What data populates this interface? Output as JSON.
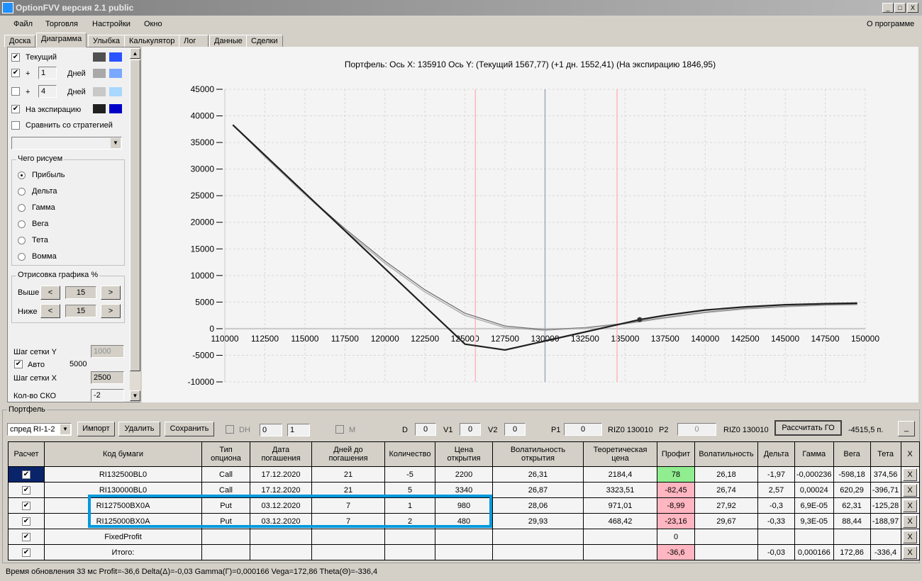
{
  "window": {
    "title": "OptionFVV версия 2.1 public",
    "min": "_",
    "max": "□",
    "close": "X"
  },
  "menu": [
    "Файл",
    "Торговля",
    "Настройки",
    "Окно"
  ],
  "about": "О программе",
  "tabs": [
    "Доска",
    "Диаграмма",
    "Улыбка",
    "Калькулятор",
    "Лог",
    "Данные",
    "Сделки"
  ],
  "left": {
    "current": "Текущий",
    "plus": "+",
    "days": "Дней",
    "days1": "1",
    "days2": "4",
    "expiry": "На экспирацию",
    "compare": "Сравнить со стратегией",
    "what_caption": "Чего рисуем",
    "radios": [
      "Прибыль",
      "Дельта",
      "Гамма",
      "Вега",
      "Тета",
      "Вомма"
    ],
    "draw_caption": "Отрисовка графика %",
    "above": "Выше",
    "below": "Ниже",
    "above_val": "15",
    "below_val": "15",
    "lt": "<",
    "gt": ">",
    "grid_y": "Шаг сетки Y",
    "grid_y_val": "1000",
    "auto": "Авто",
    "auto_val": "5000",
    "grid_x": "Шаг сетки X",
    "grid_x_val": "2500",
    "sko": "Кол-во СКО",
    "sko_val": "-2",
    "colors": {
      "current": [
        "#505050",
        "#2a52ff"
      ],
      "plus1": [
        "#a8a8a8",
        "#78a8ff"
      ],
      "plus4": [
        "#c8c8c8",
        "#a8d8ff"
      ],
      "expiry": [
        "#202020",
        "#0000c8"
      ]
    }
  },
  "chart_data": {
    "type": "line",
    "title": "Портфель: Ось X: 135910 Ось Y:  (Текущий 1567,77)  (+1 дн. 1552,41)  (На экспирацию 1846,95)",
    "xlim": [
      110000,
      150000
    ],
    "ylim": [
      -10000,
      45000
    ],
    "grid": true,
    "xticks": [
      110000,
      112500,
      115000,
      117500,
      120000,
      122500,
      125000,
      127500,
      130000,
      132500,
      135000,
      137500,
      140000,
      142500,
      145000,
      147500,
      150000
    ],
    "yticks": [
      45000,
      40000,
      35000,
      30000,
      25000,
      20000,
      15000,
      10000,
      5000,
      0,
      -5000,
      -10000
    ],
    "vlines": [
      {
        "x": 125650,
        "color": "#ffb6c1"
      },
      {
        "x": 130000,
        "color": "#a0a8b8"
      },
      {
        "x": 134500,
        "color": "#ffb6c1"
      }
    ],
    "marker": {
      "x": 135910,
      "y": 1700
    },
    "series": [
      {
        "name": "Текущий",
        "color": "#707070",
        "x": [
          110500,
          112500,
          115000,
          117500,
          120000,
          122500,
          125000,
          127500,
          130000,
          132500,
          135000,
          137500,
          140000,
          142500,
          145000,
          147500,
          149500
        ],
        "y": [
          38300,
          32400,
          25400,
          18800,
          12700,
          7300,
          2900,
          500,
          -200,
          200,
          1000,
          2100,
          3100,
          3800,
          4200,
          4500,
          4600
        ]
      },
      {
        "name": "+1 дн.",
        "color": "#a8a8a8",
        "x": [
          110500,
          112500,
          115000,
          117500,
          120000,
          122500,
          125000,
          127500,
          130000,
          132500,
          135000,
          137500,
          140000,
          142500,
          145000,
          147500,
          149500
        ],
        "y": [
          38300,
          32300,
          25200,
          18500,
          12300,
          6900,
          2500,
          200,
          -300,
          100,
          900,
          2000,
          3000,
          3700,
          4100,
          4400,
          4500
        ]
      },
      {
        "name": "На экспирацию",
        "color": "#202020",
        "x": [
          110500,
          125000,
          127500,
          135910,
          137500,
          140000,
          142500,
          145000,
          147500,
          149500
        ],
        "y": [
          38300,
          -2900,
          -4000,
          1700,
          2500,
          3500,
          4100,
          4500,
          4700,
          4800
        ]
      }
    ]
  },
  "portfolio": {
    "caption": "Портфель",
    "select": "спред RI-1-2",
    "import": "Импорт",
    "delete": "Удалить",
    "save": "Сохранить",
    "dh": "DH",
    "spin1": "0",
    "spin2": "1",
    "m": "M",
    "d": "D",
    "d_val": "0",
    "v1": "V1",
    "v1_val": "0",
    "v2": "V2",
    "v2_val": "0",
    "p1": "P1",
    "p1_val": "0",
    "p1_code": "RIZ0 130010",
    "p2": "P2",
    "p2_val": "0",
    "p2_code": "RIZ0 130010",
    "calc": "Рассчитать ГО",
    "go_val": "-4515,5 п.",
    "min": "_"
  },
  "table": {
    "headers": [
      "Расчет",
      "Код бумаги",
      "Тип\nопциона",
      "Дата\nпогашения",
      "Дней до\nпогашения",
      "Количество",
      "Цена\nоткрытия",
      "Волатильность\nоткрытия",
      "Теоретическая\nцена",
      "Профит",
      "Волатильность",
      "Дельта",
      "Гамма",
      "Вега",
      "Тета",
      "X"
    ],
    "rows": [
      [
        "✔",
        "RI132500BL0",
        "Call",
        "17.12.2020",
        "21",
        "-5",
        "2200",
        "26,31",
        "2184,4",
        "78",
        "26,18",
        "-1,97",
        "-0,000236",
        "-598,18",
        "374,56",
        "X"
      ],
      [
        "✔",
        "RI130000BL0",
        "Call",
        "17.12.2020",
        "21",
        "5",
        "3340",
        "26,87",
        "3323,51",
        "-82,45",
        "26,74",
        "2,57",
        "0,00024",
        "620,29",
        "-396,71",
        "X"
      ],
      [
        "✔",
        "RI127500BX0A",
        "Put",
        "03.12.2020",
        "7",
        "1",
        "980",
        "28,06",
        "971,01",
        "-8,99",
        "27,92",
        "-0,3",
        "6,9E-05",
        "62,31",
        "-125,28",
        "X"
      ],
      [
        "✔",
        "RI125000BX0A",
        "Put",
        "03.12.2020",
        "7",
        "2",
        "480",
        "29,93",
        "468,42",
        "-23,16",
        "29,67",
        "-0,33",
        "9,3E-05",
        "88,44",
        "-188,97",
        "X"
      ],
      [
        "✔",
        "FixedProfit",
        "",
        "",
        "",
        "",
        "",
        "",
        "",
        "0",
        "",
        "",
        "",
        "",
        "",
        "X"
      ],
      [
        "✔",
        "Итого:",
        "",
        "",
        "",
        "",
        "",
        "",
        "",
        "-36,6",
        "",
        "-0,03",
        "0,000166",
        "172,86",
        "-336,4",
        "X"
      ]
    ],
    "profit_class": [
      "g",
      "r",
      "r",
      "r",
      "",
      "r"
    ]
  },
  "status": "Время обновления 33 мс  Profit=-36,6 Delta(Δ)=-0,03 Gamma(Γ)=0,000166 Vega=172,86 Theta(Θ)=-336,4"
}
